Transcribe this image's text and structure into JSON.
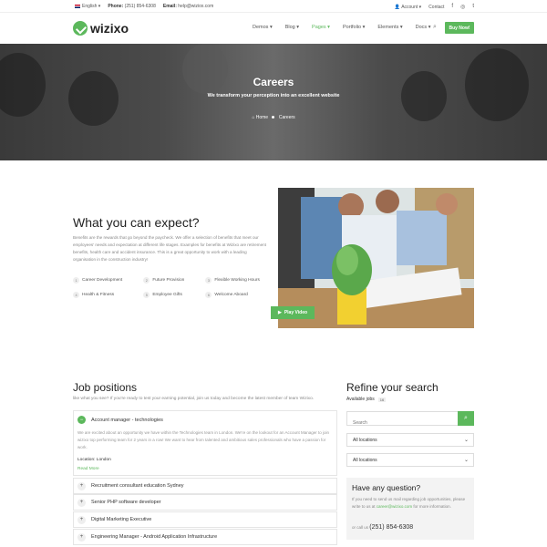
{
  "topbar": {
    "language": "English",
    "phone_label": "Phone:",
    "phone_value": "(251) 854-6308",
    "email_label": "Email:",
    "email_value": "help@wiziox.com",
    "account": "Account",
    "contact": "Contact",
    "social": [
      "f",
      "◎",
      "t"
    ]
  },
  "header": {
    "logo": "wizixo",
    "nav": [
      "Demos",
      "Blog",
      "Pages",
      "Portfolio",
      "Elements",
      "Docs"
    ],
    "buy_button": "Buy Now!"
  },
  "hero": {
    "title": "Careers",
    "subtitle": "We transform your perception into an excellent website",
    "breadcrumb_home": "Home",
    "breadcrumb_current": "Careers"
  },
  "expect": {
    "title": "What you can expect?",
    "text": "Benefits are the rewards that go beyond the paycheck. We offer a selection of benefits that meet our employees' needs and expectation at different life stages. Examples for benefits at Wizixo are retirement benefits, health care and accident insurance. This is a great opportunity to work with a leading organisation in the construction industry!",
    "features": [
      {
        "num": "1",
        "label": "Career Development"
      },
      {
        "num": "2",
        "label": "Future Provision"
      },
      {
        "num": "3",
        "label": "Flexible Working Hours"
      },
      {
        "num": "4",
        "label": "Health & Fitness"
      },
      {
        "num": "5",
        "label": "Employee Gifts"
      },
      {
        "num": "6",
        "label": "Welcome Aboard"
      }
    ],
    "play_video": "Play Video"
  },
  "jobs": {
    "title": "Job positions",
    "subtitle": "like what you see? If you're ready to test your earning potential, join us today and become the latest member of team Wizixo.",
    "open_job": {
      "title": "Account manager - technologies",
      "description": "We are excited about an opportunity we have within the Technologies team in London. We're on the lookout for an Account Manager to join wizixo top performing team for 2 years in a row! We want to hear from talented and ambitious sales professionals who have a passion for work.",
      "location": "Location: London",
      "read_more": "Read More"
    },
    "other_jobs": [
      "Recruitment consultant education Sydney",
      "Senior PHP software developer",
      "Digital Marketing Executive",
      "Engineering Manager - Android Application Infrastructure"
    ]
  },
  "refine": {
    "title": "Refine your search",
    "available_label": "Available jobs",
    "available_count": "16",
    "search_placeholder": "Search",
    "location_select_1": "All locations",
    "location_select_2": "All locations",
    "question_title": "Have any question?",
    "question_text_pre": "If you need to send us mail regarding job opportunities, please write to us at ",
    "question_email": "career@wizixo.com",
    "question_text_post": " for more information.",
    "call_prefix": "or call us",
    "call_number": "(251) 854-6308"
  },
  "colors": {
    "accent": "#5cb85c"
  }
}
